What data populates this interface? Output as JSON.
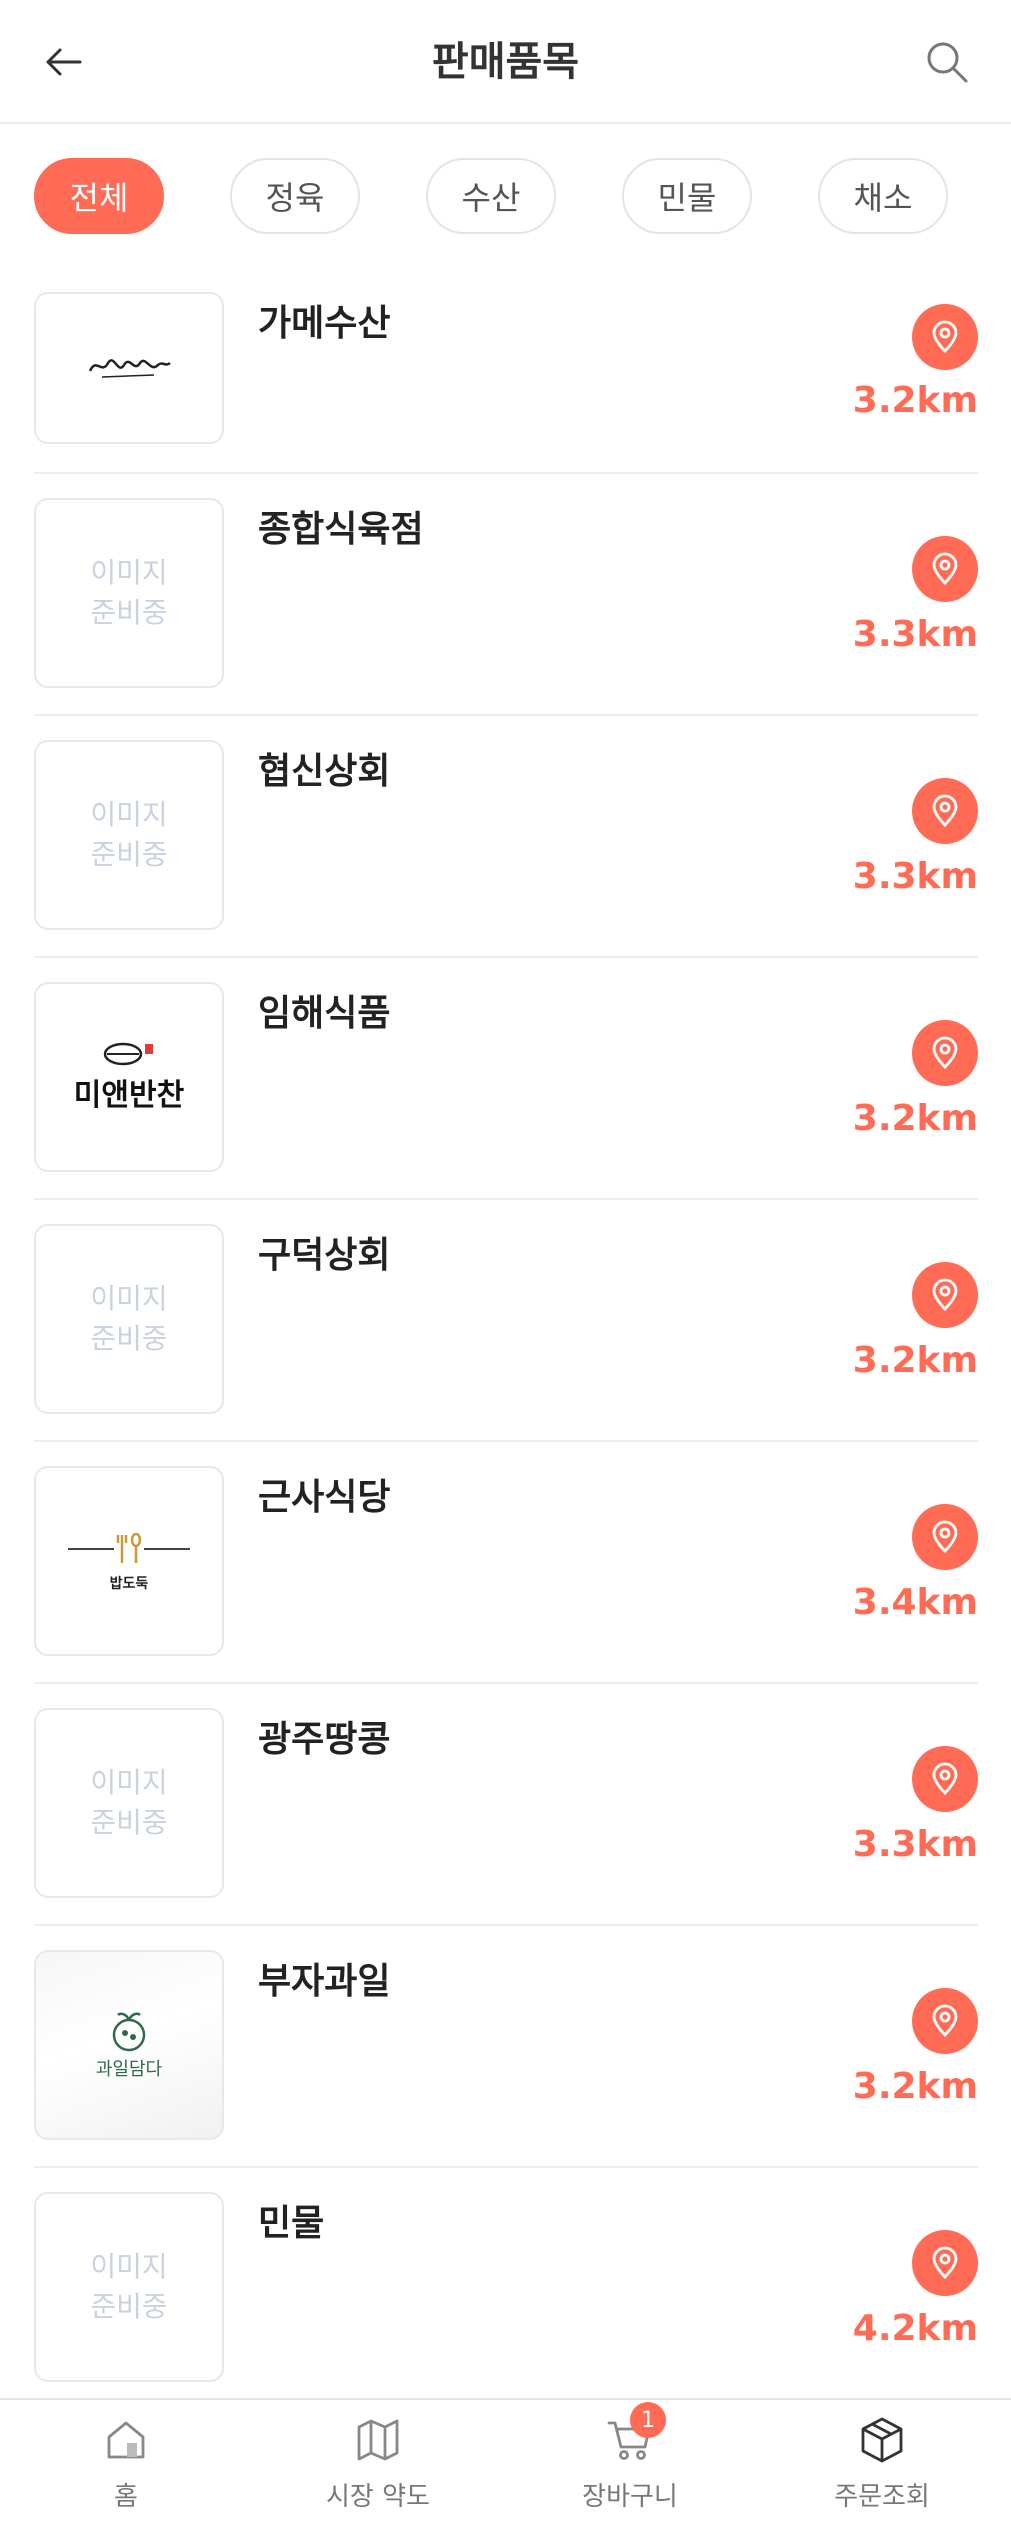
{
  "header": {
    "title": "판매품목"
  },
  "chips": [
    {
      "label": "전체",
      "active": true
    },
    {
      "label": "정육",
      "active": false
    },
    {
      "label": "수산",
      "active": false
    },
    {
      "label": "민물",
      "active": false
    },
    {
      "label": "채소",
      "active": false
    }
  ],
  "placeholder": {
    "line1": "이미지",
    "line2": "준비중"
  },
  "stores": [
    {
      "name": "가메수산",
      "distance": "3.2km",
      "logo": "gamesusan"
    },
    {
      "name": "종합식육점",
      "distance": "3.3km",
      "logo": ""
    },
    {
      "name": "협신상회",
      "distance": "3.3km",
      "logo": ""
    },
    {
      "name": "임해식품",
      "distance": "3.2km",
      "logo": "miaen"
    },
    {
      "name": "구덕상회",
      "distance": "3.2km",
      "logo": ""
    },
    {
      "name": "근사식당",
      "distance": "3.4km",
      "logo": "babdoduk"
    },
    {
      "name": "광주땅콩",
      "distance": "3.3km",
      "logo": ""
    },
    {
      "name": "부자과일",
      "distance": "3.2km",
      "logo": "fruit"
    },
    {
      "name": "민물",
      "distance": "4.2km",
      "logo": ""
    }
  ],
  "logos": {
    "miaen_text": "미앤반찬",
    "babdoduk_text": "밥도둑",
    "fruit_text": "과일담다"
  },
  "tabbar": [
    {
      "label": "홈",
      "icon": "home-icon"
    },
    {
      "label": "시장 약도",
      "icon": "map-icon"
    },
    {
      "label": "장바구니",
      "icon": "cart-icon",
      "badge": "1"
    },
    {
      "label": "주문조회",
      "icon": "box-icon"
    }
  ],
  "colors": {
    "accent": "#ff6b55",
    "placeholder": "#c9d3df"
  }
}
